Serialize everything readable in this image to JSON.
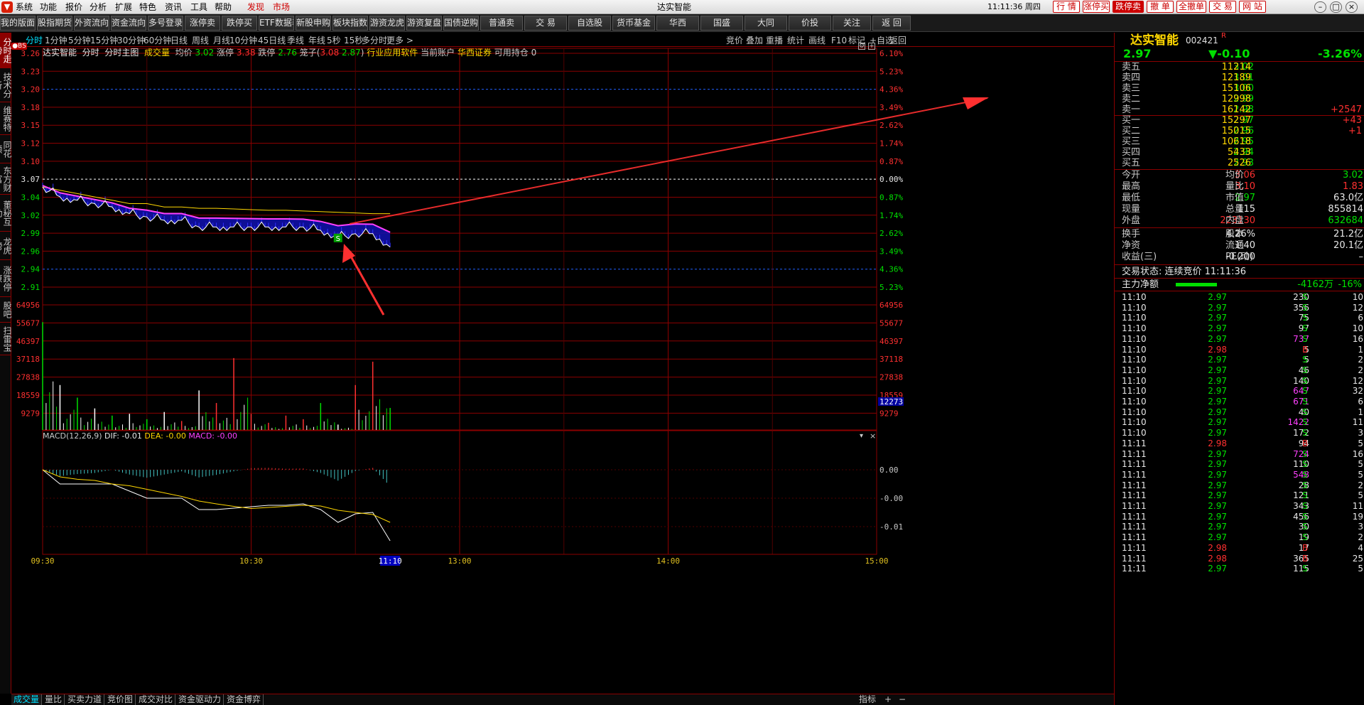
{
  "menubar": {
    "items": [
      "系统",
      "功能",
      "报价",
      "分析",
      "扩展",
      "特色",
      "资讯",
      "工具",
      "帮助",
      "发现",
      "市场"
    ],
    "title": "达实智能",
    "clock": "11:11:36 周四",
    "quick": [
      "行 情",
      "涨停买",
      "跌停卖",
      "撤 单",
      "全撤单",
      "交 易",
      "网 站"
    ]
  },
  "toolbar": [
    "我的版面",
    "股指期货",
    "外资流向",
    "资金流向",
    "多号登录",
    "涨停卖",
    "跌停买",
    "ETF数据表",
    "新股申购",
    "板块指数",
    "游资龙虎",
    "游资复盘",
    "国债逆购",
    "普通卖",
    "交 易",
    "自选股",
    "货币基金",
    "华西",
    "国盛",
    "大同",
    "价投",
    "关注",
    "返 回"
  ],
  "lefttabs": [
    "分时走势",
    "技术分析",
    "维赛特",
    "同花顺",
    "东方财富",
    "董秘互动",
    "龙虎榜",
    "涨跌停原",
    "股吧",
    "扫雷宝"
  ],
  "periods": [
    "分时",
    "1分钟",
    "5分钟",
    "15分钟",
    "30分钟",
    "60分钟",
    "日线",
    "周线",
    "月线",
    "10分钟",
    "45日线",
    "季线",
    "年线",
    "5秒",
    "15秒",
    "多分时",
    "更多 >"
  ],
  "period_tools": [
    "竞价",
    "叠加",
    "重播",
    "统计",
    "画线",
    "F10",
    "标记",
    "+自选",
    "返回"
  ],
  "info": {
    "name": "达实智能",
    "mode": "分时",
    "main": "分时主图",
    "vol": "成交量",
    "avg_label": "均价",
    "avg": "3.02",
    "up_label": "涨停",
    "up": "3.38",
    "down_label": "跌停",
    "down": "2.76",
    "cage_label": "笼子(",
    "cage_hi": "3.08",
    "cage_lo": "2.87",
    "cage_end": ")",
    "industry": "行业应用软件",
    "account_label": "当前账户",
    "account": "华西证券",
    "hold": "可用持仓 0"
  },
  "price_axis": [
    "3.26",
    "3.23",
    "3.20",
    "3.18",
    "3.15",
    "3.12",
    "3.10",
    "3.07",
    "3.04",
    "3.02",
    "2.99",
    "2.96",
    "2.94",
    "2.91"
  ],
  "pct_axis": [
    "6.10%",
    "5.23%",
    "4.36%",
    "3.49%",
    "2.62%",
    "1.74%",
    "0.87%",
    "0.00%",
    "0.87%",
    "1.74%",
    "2.62%",
    "3.49%",
    "4.36%",
    "5.23%"
  ],
  "vol_axis": [
    "64956",
    "55677",
    "46397",
    "37118",
    "27838",
    "18559",
    "9279"
  ],
  "vol_current": "12273",
  "macd": {
    "label": "MACD(12,26,9)",
    "dif": "DIF: -0.01",
    "dea": "DEA: -0.00",
    "macd": "MACD: -0.00"
  },
  "macd_axis": [
    "0.00",
    "-0.00",
    "-0.01"
  ],
  "time_axis": [
    "09:30",
    "10:30",
    "11:10",
    "13:00",
    "14:00",
    "15:00"
  ],
  "signal_label": "S",
  "bs_label": "●BS",
  "stock": {
    "name": "达实智能",
    "code": "002421",
    "badge": "R",
    "price": "2.97",
    "change": "▼-0.10",
    "pct": "-3.26%"
  },
  "asks": [
    {
      "label": "卖五",
      "price": "3.02",
      "vol": "11214",
      "chg": ""
    },
    {
      "label": "卖四",
      "price": "3.01",
      "vol": "12189",
      "chg": ""
    },
    {
      "label": "卖三",
      "price": "3.00",
      "vol": "15106",
      "chg": ""
    },
    {
      "label": "卖二",
      "price": "2.99",
      "vol": "12998",
      "chg": ""
    },
    {
      "label": "卖一",
      "price": "2.98",
      "vol": "16142",
      "chg": "+2547"
    }
  ],
  "bids": [
    {
      "label": "买一",
      "price": "2.97",
      "vol": "15297",
      "chg": "+43"
    },
    {
      "label": "买二",
      "price": "2.96",
      "vol": "15015",
      "chg": "+1"
    },
    {
      "label": "买三",
      "price": "2.95",
      "vol": "10618",
      "chg": ""
    },
    {
      "label": "买四",
      "price": "2.94",
      "vol": "5433",
      "chg": ""
    },
    {
      "label": "买五",
      "price": "2.93",
      "vol": "2526",
      "chg": ""
    }
  ],
  "stats": [
    {
      "l1": "今开",
      "v1": "3.06",
      "c1": "red",
      "l2": "均价",
      "v2": "3.02",
      "c2": "grn"
    },
    {
      "l1": "最高",
      "v1": "3.10",
      "c1": "red",
      "l2": "量比",
      "v2": "1.83",
      "c2": "red"
    },
    {
      "l1": "最低",
      "v1": "2.97",
      "c1": "grn",
      "l2": "市值",
      "v2": "63.0亿",
      "c2": "wht"
    },
    {
      "l1": "现量",
      "v1": "115",
      "c1": "wht",
      "l2": "总量",
      "v2": "855814",
      "c2": "wht"
    },
    {
      "l1": "外盘",
      "v1": "223130",
      "c1": "red",
      "l2": "内盘",
      "v2": "632684",
      "c2": "grn"
    }
  ],
  "stats2": [
    {
      "l1": "换手",
      "v1": "4.26%",
      "l2": "股本",
      "v2": "21.2亿"
    },
    {
      "l1": "净资",
      "v1": "1.40",
      "l2": "流通",
      "v2": "20.1亿"
    },
    {
      "l1": "收益(三)",
      "v1": "-0.200",
      "l2": "PE(动)",
      "v2": "–"
    }
  ],
  "trade_status": "交易状态: 连续竞价 11:11:36",
  "mainflow": {
    "label": "主力净额",
    "value": "-4162万",
    "pct": "-16%"
  },
  "ticks": [
    {
      "t": "11:10",
      "p": "2.97",
      "v": "230",
      "d": "S",
      "n": "10",
      "vc": "wht"
    },
    {
      "t": "11:10",
      "p": "2.97",
      "v": "356",
      "d": "S",
      "n": "12",
      "vc": "wht"
    },
    {
      "t": "11:10",
      "p": "2.97",
      "v": "75",
      "d": "S",
      "n": "6",
      "vc": "wht"
    },
    {
      "t": "11:10",
      "p": "2.97",
      "v": "97",
      "d": "S",
      "n": "10",
      "vc": "wht"
    },
    {
      "t": "11:10",
      "p": "2.97",
      "v": "737",
      "d": "S",
      "n": "16",
      "vc": "mag"
    },
    {
      "t": "11:10",
      "p": "2.98",
      "v": "5",
      "d": "B",
      "n": "1",
      "vc": "wht"
    },
    {
      "t": "11:10",
      "p": "2.97",
      "v": "5",
      "d": "S",
      "n": "2",
      "vc": "wht"
    },
    {
      "t": "11:10",
      "p": "2.97",
      "v": "46",
      "d": "S",
      "n": "2",
      "vc": "wht"
    },
    {
      "t": "11:10",
      "p": "2.97",
      "v": "140",
      "d": "S",
      "n": "12",
      "vc": "wht"
    },
    {
      "t": "11:10",
      "p": "2.97",
      "v": "647",
      "d": "S",
      "n": "32",
      "vc": "mag"
    },
    {
      "t": "11:10",
      "p": "2.97",
      "v": "671",
      "d": "S",
      "n": "6",
      "vc": "mag"
    },
    {
      "t": "11:10",
      "p": "2.97",
      "v": "40",
      "d": "S",
      "n": "1",
      "vc": "wht"
    },
    {
      "t": "11:10",
      "p": "2.97",
      "v": "1422",
      "d": "S",
      "n": "11",
      "vc": "mag"
    },
    {
      "t": "11:10",
      "p": "2.97",
      "v": "172",
      "d": "S",
      "n": "3",
      "vc": "wht"
    },
    {
      "t": "11:11",
      "p": "2.98",
      "v": "94",
      "d": "B",
      "n": "5",
      "vc": "wht"
    },
    {
      "t": "11:11",
      "p": "2.97",
      "v": "724",
      "d": "S",
      "n": "16",
      "vc": "mag"
    },
    {
      "t": "11:11",
      "p": "2.97",
      "v": "110",
      "d": "S",
      "n": "5",
      "vc": "wht"
    },
    {
      "t": "11:11",
      "p": "2.97",
      "v": "548",
      "d": "S",
      "n": "5",
      "vc": "mag"
    },
    {
      "t": "11:11",
      "p": "2.97",
      "v": "28",
      "d": "S",
      "n": "2",
      "vc": "wht"
    },
    {
      "t": "11:11",
      "p": "2.97",
      "v": "121",
      "d": "S",
      "n": "5",
      "vc": "wht"
    },
    {
      "t": "11:11",
      "p": "2.97",
      "v": "343",
      "d": "S",
      "n": "11",
      "vc": "wht"
    },
    {
      "t": "11:11",
      "p": "2.97",
      "v": "456",
      "d": "S",
      "n": "19",
      "vc": "wht"
    },
    {
      "t": "11:11",
      "p": "2.97",
      "v": "30",
      "d": "S",
      "n": "3",
      "vc": "wht"
    },
    {
      "t": "11:11",
      "p": "2.97",
      "v": "19",
      "d": "S",
      "n": "2",
      "vc": "wht"
    },
    {
      "t": "11:11",
      "p": "2.98",
      "v": "17",
      "d": "B",
      "n": "4",
      "vc": "wht"
    },
    {
      "t": "11:11",
      "p": "2.98",
      "v": "365",
      "d": "B",
      "n": "25",
      "vc": "wht"
    },
    {
      "t": "11:11",
      "p": "2.97",
      "v": "115",
      "d": "S",
      "n": "5",
      "vc": "wht"
    }
  ],
  "bottomtabs": [
    "成交量",
    "量比",
    "买卖力道",
    "竞价图",
    "成交对比",
    "资金驱动力",
    "资金博弈"
  ],
  "bottom_right": [
    "指标",
    "+",
    "−"
  ],
  "colors": {
    "up": "#ff3030",
    "down": "#00e000",
    "grid": "#8b0000",
    "price_line": "#ffffff",
    "avg_line": "#ffd700",
    "ma_line": "#ff40ff"
  },
  "chart_data": {
    "type": "line",
    "title": "",
    "xlabel": "",
    "ylabel": "",
    "x": [
      "09:30",
      "09:35",
      "09:40",
      "09:45",
      "09:50",
      "09:55",
      "10:00",
      "10:05",
      "10:10",
      "10:15",
      "10:20",
      "10:25",
      "10:30",
      "10:35",
      "10:40",
      "10:45",
      "10:50",
      "10:55",
      "11:00",
      "11:05",
      "11:10"
    ],
    "ylim": [
      2.91,
      3.26
    ],
    "prev_close": 3.07,
    "series": [
      {
        "name": "",
        "values": [
          3.06,
          3.045,
          3.04,
          3.035,
          3.03,
          3.02,
          3.015,
          3.01,
          3.01,
          3.0,
          3.0,
          3.0,
          3.0,
          3.0,
          3.0,
          3.0,
          2.995,
          2.985,
          2.99,
          2.99,
          2.97
        ]
      },
      {
        "name": "均价",
        "values": [
          3.06,
          3.055,
          3.05,
          3.045,
          3.04,
          3.035,
          3.035,
          3.03,
          3.03,
          3.028,
          3.028,
          3.027,
          3.026,
          3.025,
          3.025,
          3.024,
          3.023,
          3.022,
          3.021,
          3.02,
          3.02
        ]
      }
    ],
    "volume": [
      60000,
      25000,
      18000,
      12000,
      8000,
      9000,
      6000,
      10000,
      5000,
      22000,
      15000,
      40000,
      9000,
      4000,
      8000,
      6000,
      15000,
      3000,
      25000,
      38000,
      12273
    ]
  }
}
